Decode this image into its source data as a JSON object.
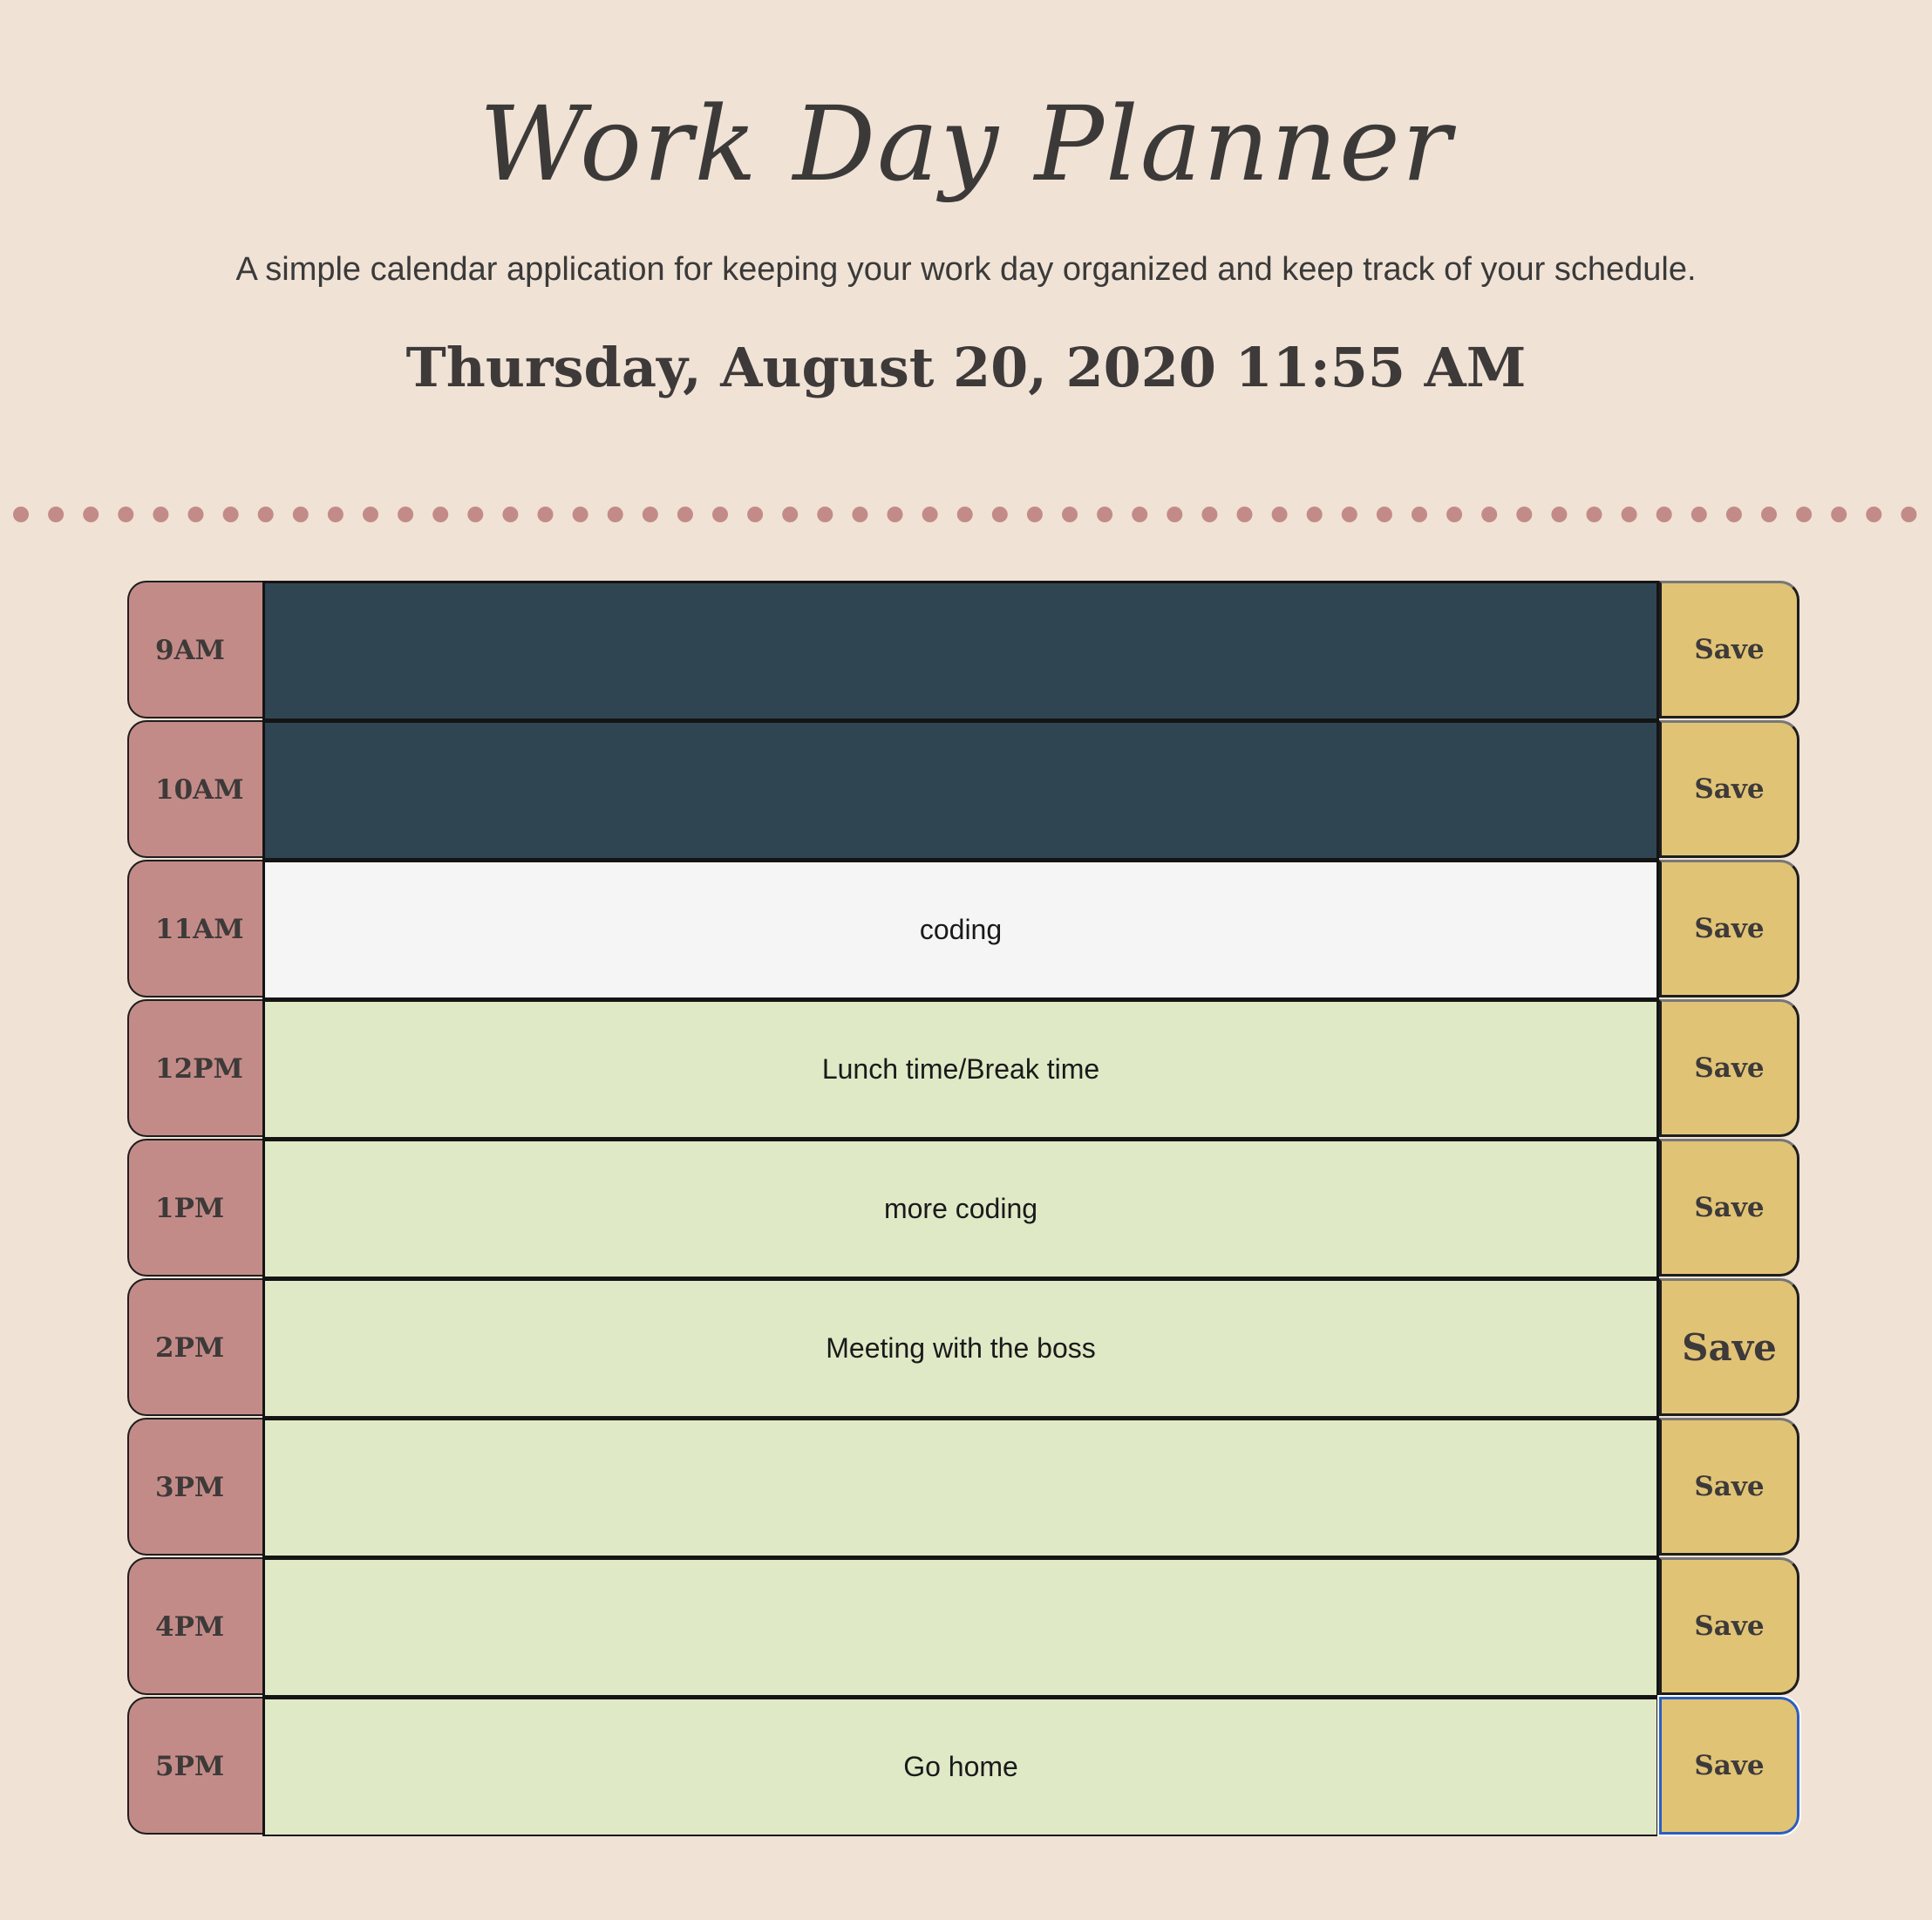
{
  "header": {
    "title": "Work Day Planner",
    "subtitle": "A simple calendar application for keeping your work day organized and keep track of your schedule.",
    "current_datetime": "Thursday, August 20, 2020 11:55 AM"
  },
  "colors": {
    "background": "#f0e2d5",
    "hour_block": "#c38b88",
    "past": "#2f4552",
    "present": "#f5f5f5",
    "future": "#dfe9c6",
    "save_button": "#e1c376",
    "dots": "#c38b88"
  },
  "rows": [
    {
      "hour": "9AM",
      "task": "",
      "state": "past",
      "save_label": "Save"
    },
    {
      "hour": "10AM",
      "task": "",
      "state": "past",
      "save_label": "Save"
    },
    {
      "hour": "11AM",
      "task": "coding",
      "state": "present",
      "save_label": "Save"
    },
    {
      "hour": "12PM",
      "task": "Lunch time/Break time",
      "state": "future",
      "save_label": "Save"
    },
    {
      "hour": "1PM",
      "task": "more coding",
      "state": "future",
      "save_label": "Save"
    },
    {
      "hour": "2PM",
      "task": "Meeting with the boss",
      "state": "future",
      "save_label": "Save"
    },
    {
      "hour": "3PM",
      "task": "",
      "state": "future",
      "save_label": "Save"
    },
    {
      "hour": "4PM",
      "task": "",
      "state": "future",
      "save_label": "Save"
    },
    {
      "hour": "5PM",
      "task": "Go home",
      "state": "future",
      "save_label": "Save"
    }
  ]
}
